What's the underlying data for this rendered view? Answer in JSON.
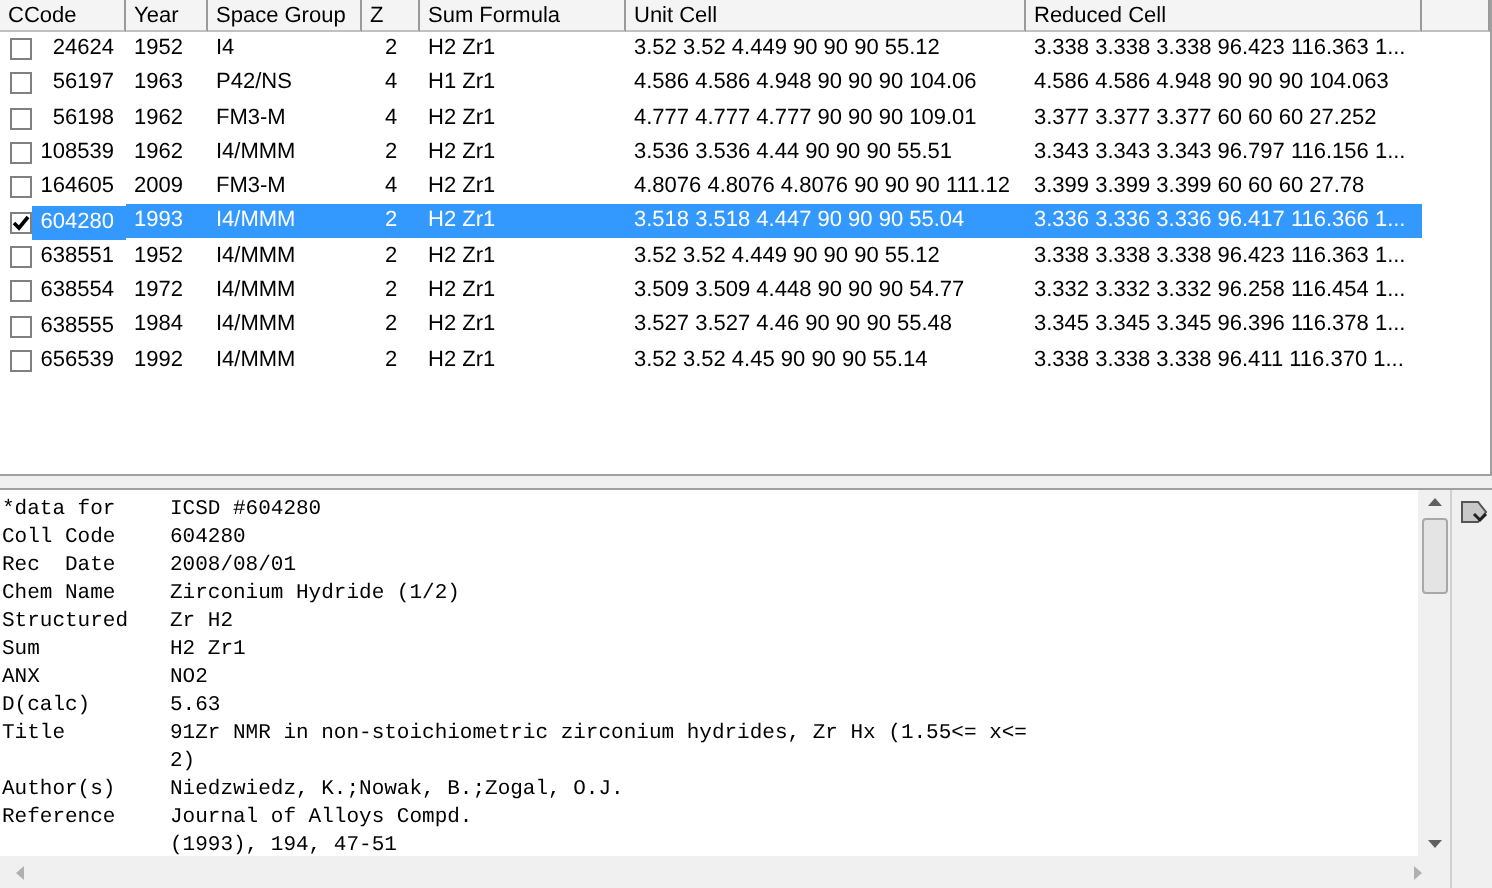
{
  "table": {
    "columns": [
      "CCode",
      "Year",
      "Space Group",
      "Z",
      "Sum Formula",
      "Unit Cell",
      "Reduced Cell"
    ],
    "rows": [
      {
        "checked": false,
        "selected": false,
        "cells": [
          "24624",
          "1952",
          "I4",
          "2",
          "H2 Zr1",
          "3.52 3.52 4.449 90 90 90 55.12",
          "3.338 3.338 3.338 96.423 116.363 1..."
        ]
      },
      {
        "checked": false,
        "selected": false,
        "cells": [
          "56197",
          "1963",
          "P42/NS",
          "4",
          "H1 Zr1",
          "4.586 4.586 4.948 90 90 90 104.06",
          "4.586 4.586 4.948 90 90 90 104.063"
        ]
      },
      {
        "checked": false,
        "selected": false,
        "cells": [
          "56198",
          "1962",
          "FM3-M",
          "4",
          "H2 Zr1",
          "4.777 4.777 4.777 90 90 90 109.01",
          "3.377 3.377 3.377 60 60 60 27.252"
        ]
      },
      {
        "checked": false,
        "selected": false,
        "cells": [
          "108539",
          "1962",
          "I4/MMM",
          "2",
          "H2 Zr1",
          "3.536 3.536 4.44 90 90 90 55.51",
          "3.343 3.343 3.343 96.797 116.156 1..."
        ]
      },
      {
        "checked": false,
        "selected": false,
        "cells": [
          "164605",
          "2009",
          "FM3-M",
          "4",
          "H2 Zr1",
          "4.8076 4.8076 4.8076 90 90 90 111.12",
          "3.399 3.399 3.399 60 60 60 27.78"
        ]
      },
      {
        "checked": true,
        "selected": true,
        "cells": [
          "604280",
          "1993",
          "I4/MMM",
          "2",
          "H2 Zr1",
          "3.518 3.518 4.447 90 90 90 55.04",
          "3.336 3.336 3.336 96.417 116.366 1..."
        ]
      },
      {
        "checked": false,
        "selected": false,
        "cells": [
          "638551",
          "1952",
          "I4/MMM",
          "2",
          "H2 Zr1",
          "3.52 3.52 4.449 90 90 90 55.12",
          "3.338 3.338 3.338 96.423 116.363 1..."
        ]
      },
      {
        "checked": false,
        "selected": false,
        "cells": [
          "638554",
          "1972",
          "I4/MMM",
          "2",
          "H2 Zr1",
          "3.509 3.509 4.448 90 90 90 54.77",
          "3.332 3.332 3.332 96.258 116.454 1..."
        ]
      },
      {
        "checked": false,
        "selected": false,
        "cells": [
          "638555",
          "1984",
          "I4/MMM",
          "2",
          "H2 Zr1",
          "3.527 3.527 4.46 90 90 90 55.48",
          "3.345 3.345 3.345 96.396 116.378 1..."
        ]
      },
      {
        "checked": false,
        "selected": false,
        "cells": [
          "656539",
          "1992",
          "I4/MMM",
          "2",
          "H2 Zr1",
          "3.52 3.52 4.45 90 90 90 55.14",
          "3.338 3.338 3.338 96.411 116.370 1..."
        ]
      }
    ]
  },
  "details": [
    {
      "label": "*data for",
      "lines": [
        "ICSD #604280"
      ]
    },
    {
      "label": "Coll Code",
      "lines": [
        "604280"
      ]
    },
    {
      "label": "Rec  Date",
      "lines": [
        "2008/08/01"
      ]
    },
    {
      "label": "Chem Name",
      "lines": [
        "Zirconium Hydride (1/2)"
      ]
    },
    {
      "label": "Structured",
      "lines": [
        "Zr H2"
      ]
    },
    {
      "label": "Sum",
      "lines": [
        "H2 Zr1"
      ]
    },
    {
      "label": "ANX",
      "lines": [
        "NO2"
      ]
    },
    {
      "label": "D(calc)",
      "lines": [
        "5.63"
      ]
    },
    {
      "label": "Title",
      "lines": [
        "91Zr NMR in non-stoichiometric zirconium hydrides, Zr Hx (1.55<= x<=",
        "2)"
      ]
    },
    {
      "label": "Author(s)",
      "lines": [
        "Niedzwiedz, K.;Nowak, B.;Zogal, O.J."
      ]
    },
    {
      "label": "Reference",
      "lines": [
        "Journal of Alloys Compd.",
        "(1993), 194, 47-51"
      ]
    }
  ]
}
